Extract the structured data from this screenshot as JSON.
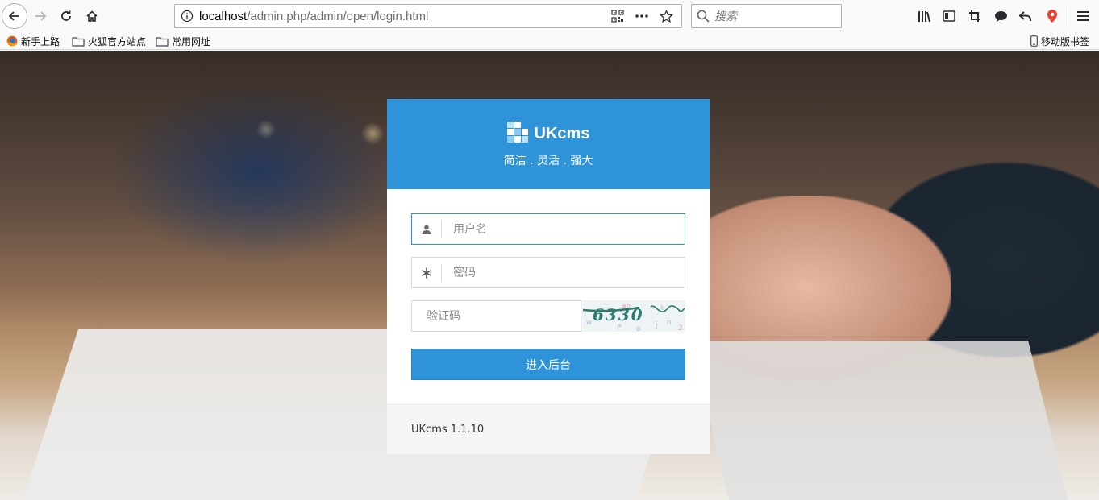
{
  "browser": {
    "url_host": "localhost",
    "url_path": "/admin.php/admin/open/login.html",
    "search_placeholder": "搜索"
  },
  "bookmarks": {
    "items": [
      {
        "label": "新手上路",
        "icon": "firefox-icon"
      },
      {
        "label": "火狐官方站点",
        "icon": "folder-icon"
      },
      {
        "label": "常用网址",
        "icon": "folder-icon"
      }
    ],
    "mobile_label": "移动版书签"
  },
  "login": {
    "brand": "UKcms",
    "slogan": "简洁 . 灵活 . 强大",
    "username_placeholder": "用户名",
    "password_placeholder": "密码",
    "captcha_placeholder": "验证码",
    "submit_label": "进入后台",
    "version": "UKcms 1.1.10",
    "captcha_text": "6330"
  },
  "colors": {
    "primary": "#2e93d8",
    "footer_bg": "#f5f5f5"
  }
}
